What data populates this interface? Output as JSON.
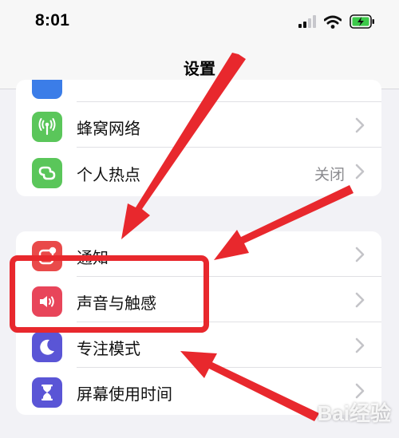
{
  "status_bar": {
    "time": "8:01"
  },
  "nav": {
    "title": "设置"
  },
  "group1": {
    "rows": [
      {
        "label": "蜂窝网络",
        "value": "",
        "icon": "antenna-icon",
        "color": "#5ac65a"
      },
      {
        "label": "个人热点",
        "value": "关闭",
        "icon": "link-chain-icon",
        "color": "#5ac65a"
      }
    ]
  },
  "group2": {
    "rows": [
      {
        "label": "通知",
        "icon": "notification-icon",
        "color": "#e94a4a"
      },
      {
        "label": "声音与触感",
        "icon": "speaker-icon",
        "color": "#e8455a"
      },
      {
        "label": "专注模式",
        "icon": "moon-icon",
        "color": "#5a55d6"
      },
      {
        "label": "屏幕使用时间",
        "icon": "hourglass-icon",
        "color": "#5a55d6"
      }
    ]
  },
  "colors": {
    "background": "#f2f2f6",
    "annotation_red": "#e8282d",
    "battery_green": "#3cc94a"
  },
  "watermark": {
    "text": "Bai经验"
  }
}
